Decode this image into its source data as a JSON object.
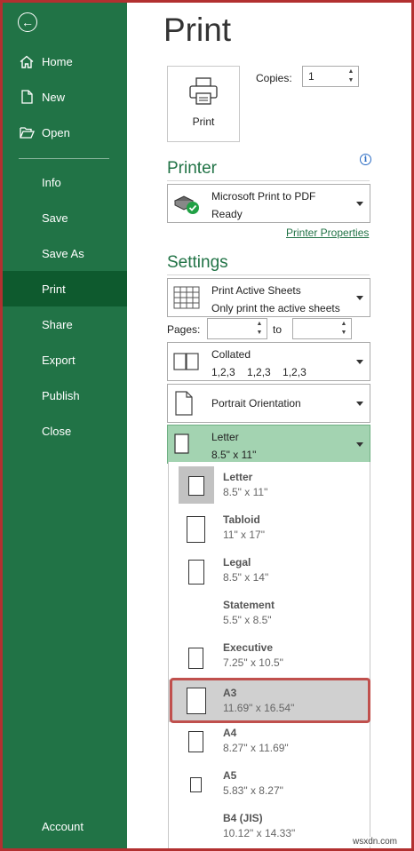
{
  "sidebar": {
    "back_icon": "arrow-left-circle-icon",
    "items": [
      {
        "label": "Home",
        "icon": "home-icon"
      },
      {
        "label": "New",
        "icon": "new-document-icon"
      },
      {
        "label": "Open",
        "icon": "folder-open-icon"
      },
      {
        "label": "Info"
      },
      {
        "label": "Save"
      },
      {
        "label": "Save As"
      },
      {
        "label": "Print",
        "active": true
      },
      {
        "label": "Share"
      },
      {
        "label": "Export"
      },
      {
        "label": "Publish"
      },
      {
        "label": "Close"
      }
    ],
    "account_label": "Account",
    "colors": {
      "background": "#217346",
      "active": "#0e5a2e"
    }
  },
  "main": {
    "title": "Print",
    "print_button_label": "Print",
    "copies_label": "Copies:",
    "copies_value": "1"
  },
  "printer": {
    "heading": "Printer",
    "name": "Microsoft Print to PDF",
    "status": "Ready",
    "properties_link": "Printer Properties"
  },
  "settings": {
    "heading": "Settings",
    "scope": {
      "title": "Print Active Sheets",
      "subtitle": "Only print the active sheets"
    },
    "pages_label": "Pages:",
    "to_label": "to",
    "pages_from": "",
    "pages_to": "",
    "collation": {
      "title": "Collated",
      "subtitle": "1,2,3    1,2,3    1,2,3"
    },
    "orientation": {
      "title": "Portrait Orientation"
    },
    "paper_size": {
      "title": "Letter",
      "subtitle": "8.5\" x 11\""
    }
  },
  "paper_options": [
    {
      "name": "Letter",
      "size": "8.5\" x 11\"",
      "selected": true
    },
    {
      "name": "Tabloid",
      "size": "11\" x 17\""
    },
    {
      "name": "Legal",
      "size": "8.5\" x 14\""
    },
    {
      "name": "Statement",
      "size": "5.5\" x 8.5\""
    },
    {
      "name": "Executive",
      "size": "7.25\" x 10.5\""
    },
    {
      "name": "A3",
      "size": "11.69\" x 16.54\"",
      "highlighted": true
    },
    {
      "name": "A4",
      "size": "8.27\" x 11.69\""
    },
    {
      "name": "A5",
      "size": "5.83\" x 8.27\""
    },
    {
      "name": "B4 (JIS)",
      "size": "10.12\" x 14.33\""
    }
  ],
  "colors": {
    "accent": "#217346",
    "highlight_border": "#c0504d",
    "dropdown_open_bg": "#a3d3b1",
    "frame_border": "#b23030"
  },
  "watermark": "wsxdn.com"
}
